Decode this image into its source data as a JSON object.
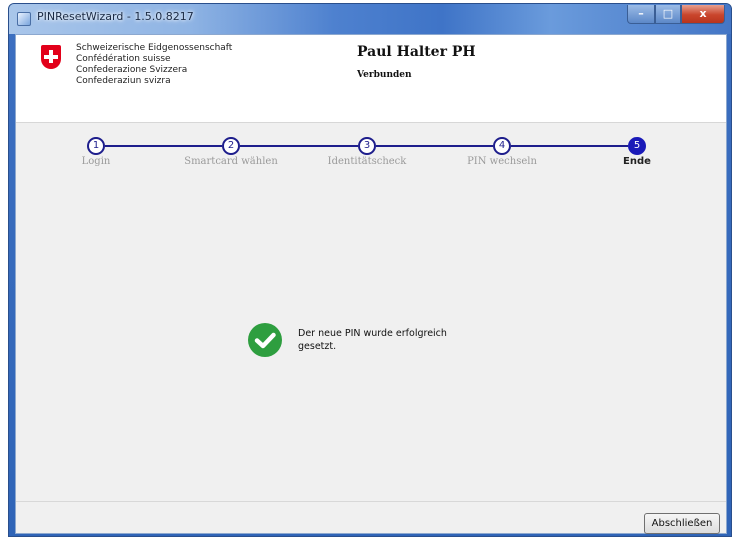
{
  "window": {
    "title": "PINResetWizard - 1.5.0.8217",
    "controls": {
      "minimize": "–",
      "maximize": "□",
      "close": "x"
    }
  },
  "header": {
    "confederation_lines": [
      "Schweizerische Eidgenossenschaft",
      "Confédération suisse",
      "Confederazione Svizzera",
      "Confederaziun svizra"
    ],
    "user_name": "Paul Halter PH",
    "connection_status": "Verbunden"
  },
  "steps": [
    {
      "number": "1",
      "label": "Login",
      "active": false
    },
    {
      "number": "2",
      "label": "Smartcard wählen",
      "active": false
    },
    {
      "number": "3",
      "label": "Identitätscheck",
      "active": false
    },
    {
      "number": "4",
      "label": "PIN wechseln",
      "active": false
    },
    {
      "number": "5",
      "label": "Ende",
      "active": true
    }
  ],
  "message": {
    "line1": "Der neue PIN wurde erfolgreich",
    "line2": "gesetzt."
  },
  "footer": {
    "finish_button": "Abschließen"
  },
  "colors": {
    "step_accent": "#1e1e8c",
    "success_green": "#2e9e3f",
    "swiss_red": "#e2001a"
  }
}
